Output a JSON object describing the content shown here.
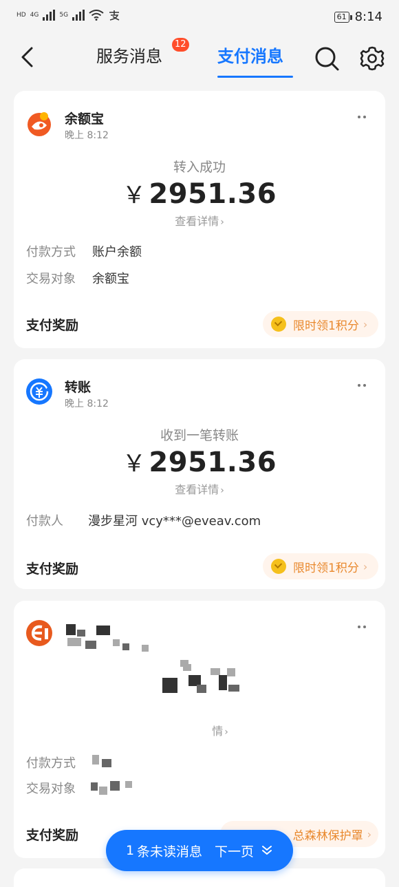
{
  "status_bar": {
    "left_tags": [
      "HD",
      "4G",
      "5G"
    ],
    "battery": "61",
    "time": "8:14"
  },
  "header": {
    "tabs": [
      {
        "label": "服务消息",
        "badge": "12"
      },
      {
        "label": "支付消息"
      }
    ],
    "active_tab": "支付消息",
    "accent_color": "#1677ff"
  },
  "cards": [
    {
      "app": "余额宝",
      "time": "晚上 8:12",
      "status": "转入成功",
      "currency": "￥",
      "amount": "2951.36",
      "detail_link": "查看详情",
      "rows": [
        {
          "label": "付款方式",
          "value": "账户余额"
        },
        {
          "label": "交易对象",
          "value": "余额宝"
        }
      ],
      "reward_label": "支付奖励",
      "reward_pill": "限时领1积分"
    },
    {
      "app": "转账",
      "time": "晚上 8:12",
      "status": "收到一笔转账",
      "currency": "￥",
      "amount": "2951.36",
      "detail_link": "查看详情",
      "rows": [
        {
          "label": "付款人",
          "value": "漫步星河 vcy***@eveav.com"
        }
      ],
      "reward_label": "支付奖励",
      "reward_pill": "限时领1积分"
    },
    {
      "app": "",
      "time": "",
      "detail_link": "情",
      "rows": [
        {
          "label": "付款方式",
          "value": ""
        },
        {
          "label": "交易对象",
          "value": ""
        }
      ],
      "reward_label": "支付奖励",
      "reward_pill": "总森林保护罩"
    }
  ],
  "unread_button": {
    "count": "1",
    "text": "条未读消息",
    "next": "下一页"
  }
}
